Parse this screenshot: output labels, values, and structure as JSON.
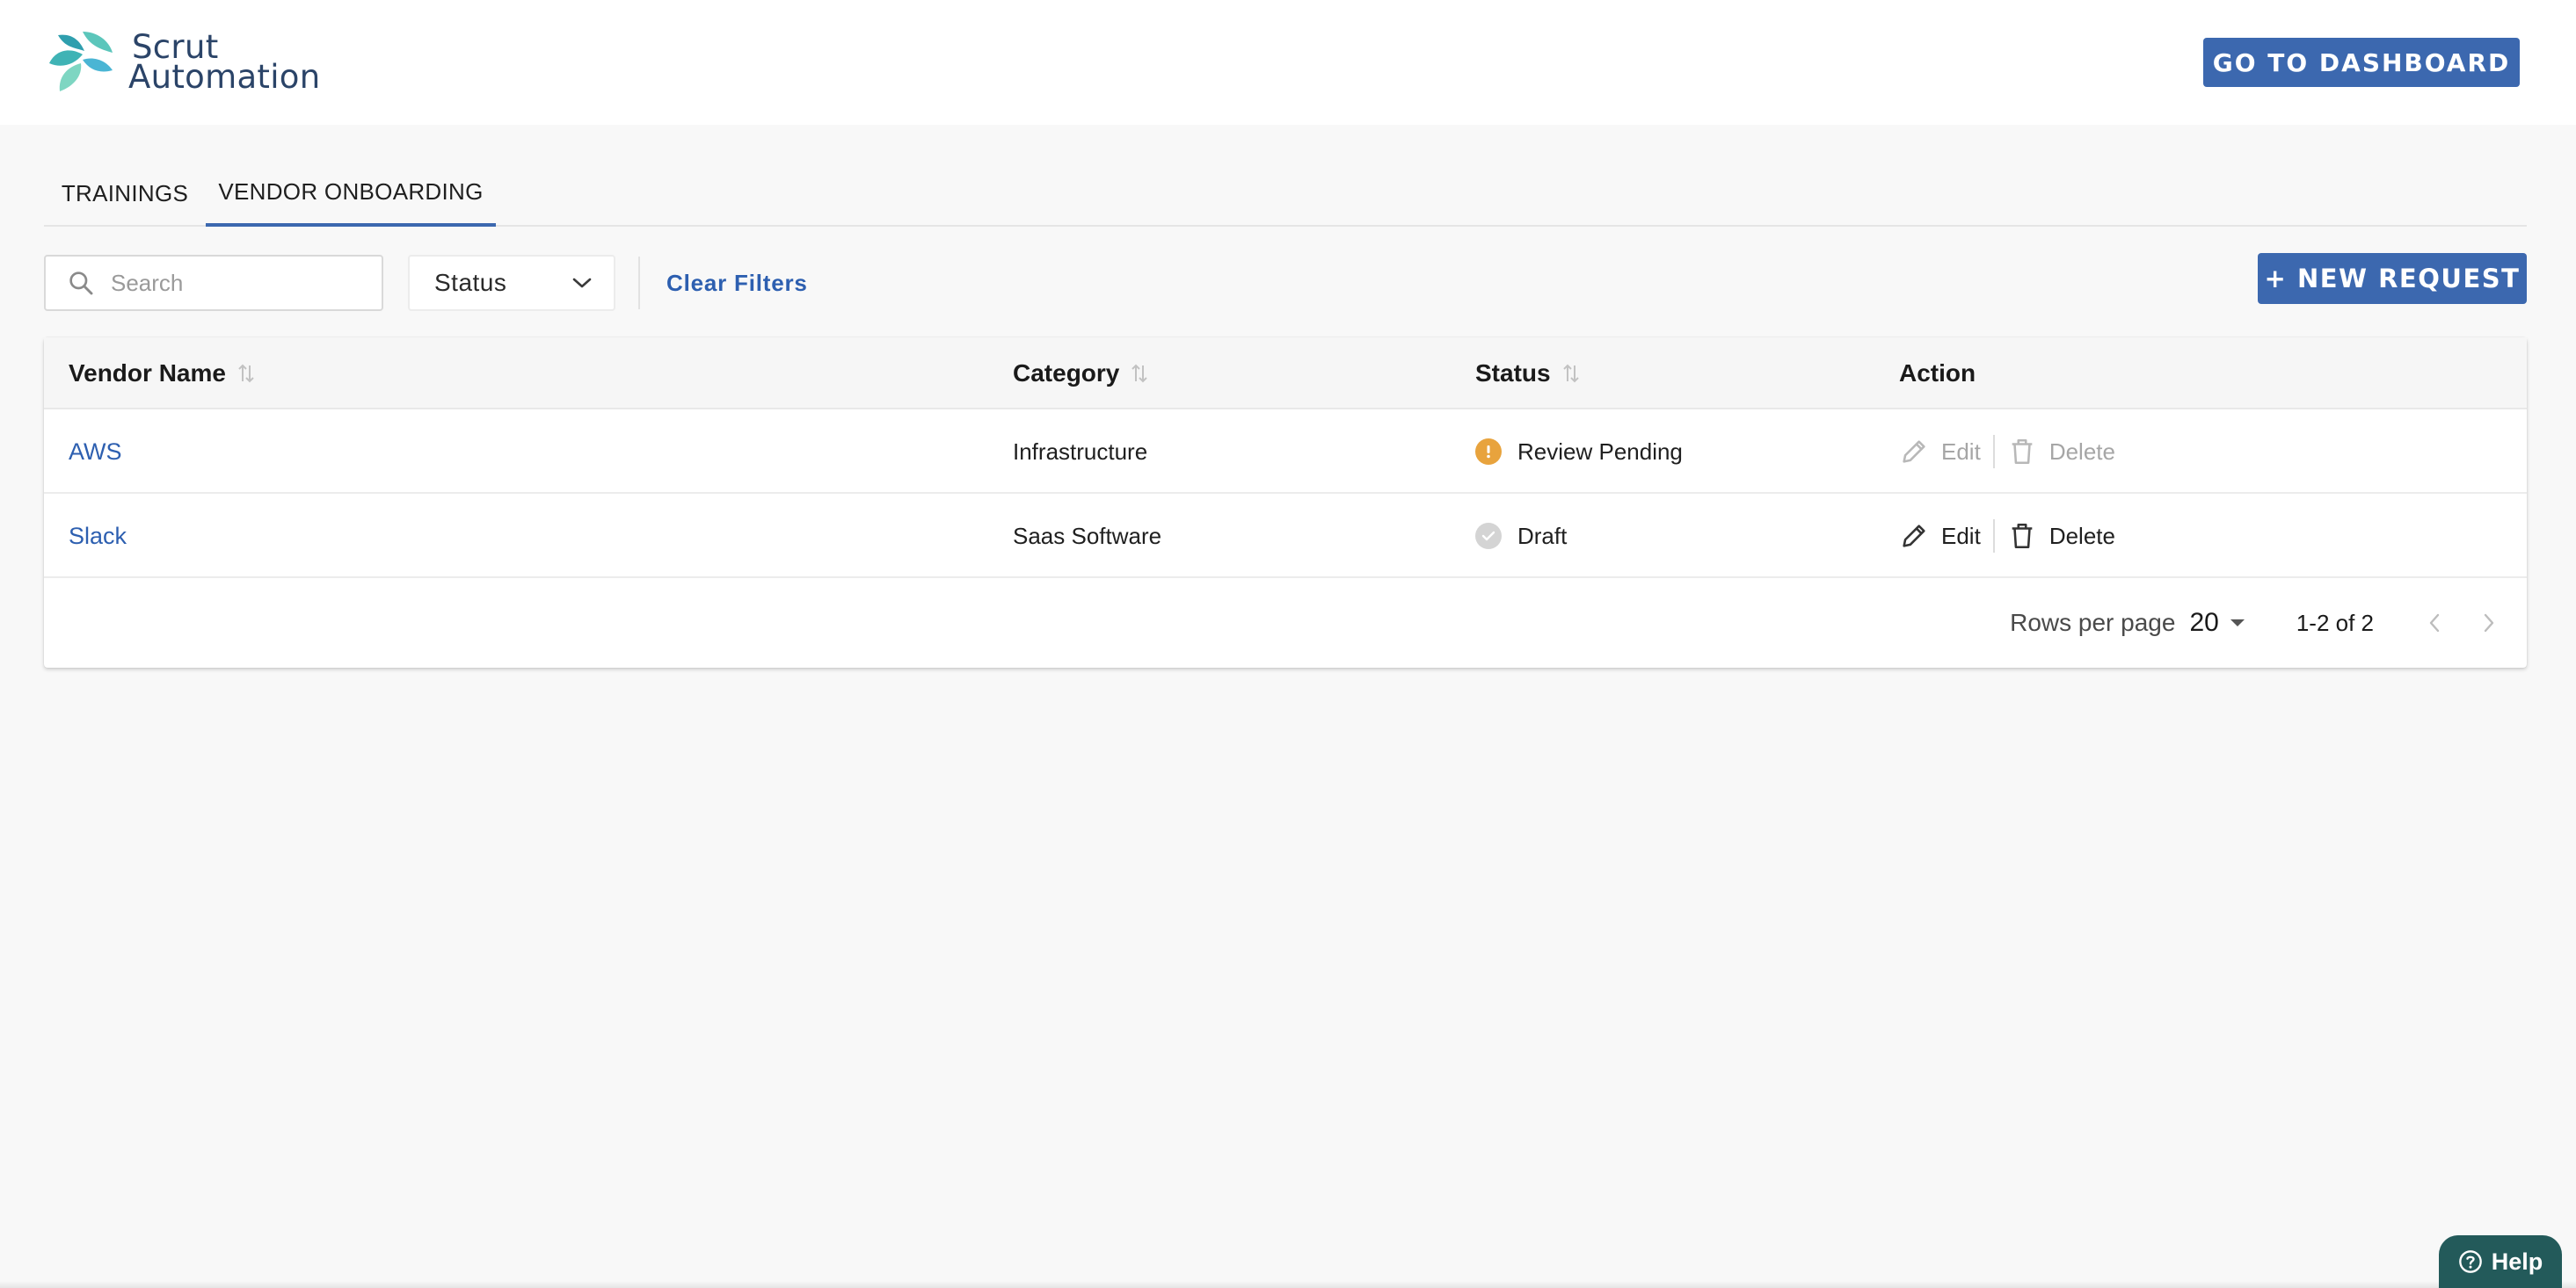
{
  "header": {
    "logo_line1": "Scrut",
    "logo_line2": "Automation",
    "dashboard_button": "GO TO DASHBOARD"
  },
  "tabs": [
    {
      "label": "TRAININGS",
      "active": false
    },
    {
      "label": "VENDOR ONBOARDING",
      "active": true
    }
  ],
  "filters": {
    "search_placeholder": "Search",
    "status_label": "Status",
    "clear_filters": "Clear Filters",
    "new_request": "+ NEW REQUEST"
  },
  "table": {
    "columns": [
      "Vendor Name",
      "Category",
      "Status",
      "Action"
    ],
    "rows": [
      {
        "vendor": "AWS",
        "category": "Infrastructure",
        "status": "Review Pending",
        "status_color": "#e8a33d",
        "actions_enabled": false,
        "edit": "Edit",
        "delete": "Delete"
      },
      {
        "vendor": "Slack",
        "category": "Saas Software",
        "status": "Draft",
        "status_color": "#d4d4d4",
        "actions_enabled": true,
        "edit": "Edit",
        "delete": "Delete"
      }
    ],
    "footer": {
      "rows_per_page_label": "Rows per page",
      "rows_per_page_value": "20",
      "range": "1-2 of 2"
    }
  },
  "help_button": "Help",
  "colors": {
    "primary": "#3c68af",
    "link": "#2d5fb0",
    "help": "#235a5a"
  }
}
